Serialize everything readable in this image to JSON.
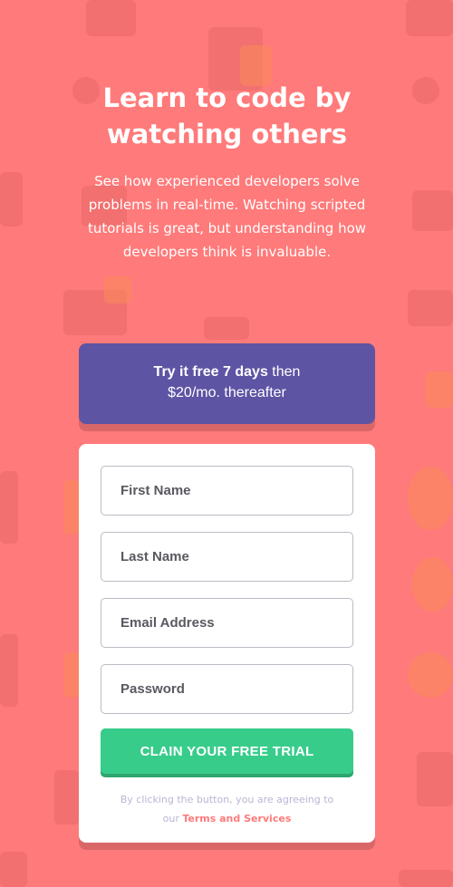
{
  "hero": {
    "title": "Learn to code by watching others",
    "description": "See how experienced developers solve problems in real-time. Watching scripted tutorials is great, but understanding how developers think is invaluable."
  },
  "promo": {
    "bold": "Try it free 7 days",
    "rest_line1": " then",
    "line2": "$20/mo. thereafter"
  },
  "form": {
    "first_name_placeholder": "First Name",
    "last_name_placeholder": "Last Name",
    "email_placeholder": "Email Address",
    "password_placeholder": "Password",
    "submit_label": "CLAIN YOUR FREE TRIAL",
    "terms_prefix": "By clicking the button, you are agreeing to",
    "terms_our": "our ",
    "terms_link": "Terms and Services"
  },
  "colors": {
    "background": "#ff7a7a",
    "promo": "#5e54a4",
    "cta": "#38cc8b"
  }
}
